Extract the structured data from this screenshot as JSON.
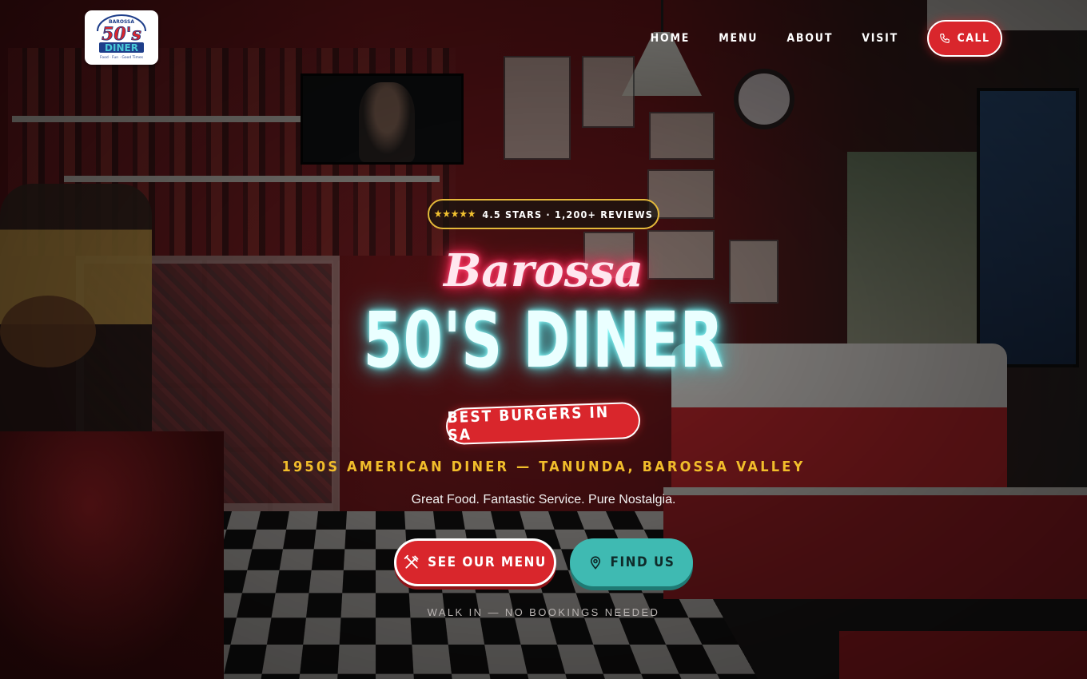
{
  "nav": {
    "logo": {
      "top_text": "BAROSSA",
      "main_text": "50's",
      "sub_text": "DINER",
      "tagline": "Food · Fun · Good Times"
    },
    "links": [
      {
        "label": "HOME"
      },
      {
        "label": "MENU"
      },
      {
        "label": "ABOUT"
      },
      {
        "label": "VISIT"
      }
    ],
    "call": {
      "label": "CALL",
      "icon": "phone-icon"
    }
  },
  "hero": {
    "rating": {
      "stars": "★★★★★",
      "text": "4.5 STARS · 1,200+ REVIEWS"
    },
    "script_title": "Barossa",
    "title": "50'S DINER",
    "ribbon": "BEST BURGERS IN SA",
    "subtitle": "1950S AMERICAN DINER — TANUNDA, BAROSSA VALLEY",
    "tagline": "Great Food. Fantastic Service. Pure Nostalgia.",
    "buttons": {
      "menu": {
        "label": "SEE OUR MENU",
        "icon": "utensils-icon"
      },
      "find": {
        "label": "FIND US",
        "icon": "map-pin-icon"
      }
    },
    "note": "WALK IN — NO BOOKINGS NEEDED"
  },
  "colors": {
    "accent_red": "#d9262c",
    "accent_teal": "#3fbab2",
    "gold": "#f1bd2b",
    "neon_cyan": "#5fe3e6",
    "neon_pink": "#ff2d5a"
  }
}
